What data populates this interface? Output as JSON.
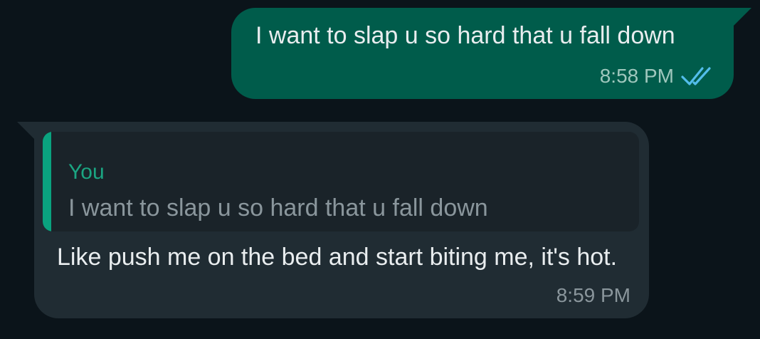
{
  "messages": {
    "outgoing": {
      "text": "I want to slap u so hard that u fall down",
      "time": "8:58 PM",
      "status_icon": "double-check-read-icon",
      "bubble_color": "#005c4b",
      "tick_color": "#53bdeb"
    },
    "incoming": {
      "quote": {
        "author": "You",
        "text": "I want to slap u so hard that u fall down",
        "accent_color": "#1ba582"
      },
      "text": "Like push me on the bed and start biting me, it's hot.",
      "time": "8:59 PM",
      "bubble_color": "#202c33"
    }
  },
  "theme": {
    "background": "#0b141a"
  }
}
